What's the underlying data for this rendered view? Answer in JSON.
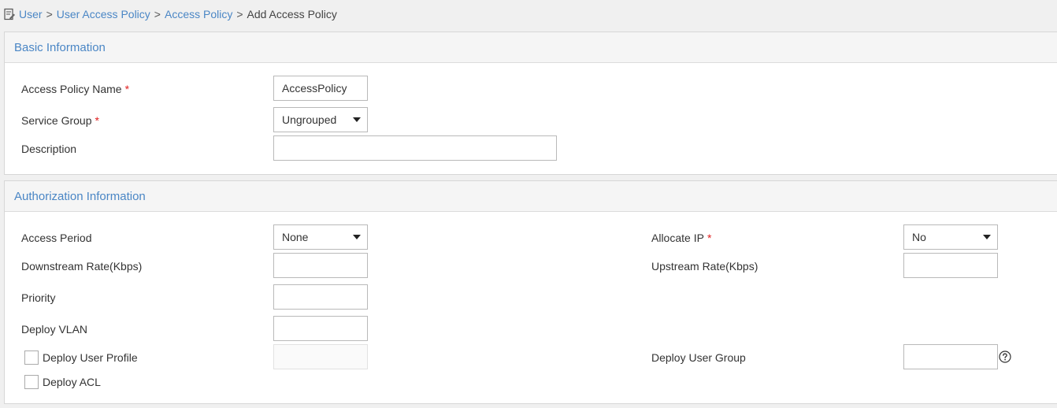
{
  "breadcrumb": {
    "items": [
      "User",
      "User Access Policy",
      "Access Policy"
    ],
    "separator": ">",
    "current": "Add Access Policy"
  },
  "basic": {
    "title": "Basic Information",
    "policy_name": {
      "label": "Access Policy Name",
      "required": "*",
      "value": "AccessPolicy"
    },
    "service_group": {
      "label": "Service Group",
      "required": "*",
      "value": "Ungrouped"
    },
    "description": {
      "label": "Description",
      "value": ""
    }
  },
  "auth": {
    "title": "Authorization Information",
    "access_period": {
      "label": "Access Period",
      "value": "None"
    },
    "allocate_ip": {
      "label": "Allocate IP",
      "required": "*",
      "value": "No"
    },
    "downstream_rate": {
      "label": "Downstream Rate(Kbps)",
      "value": ""
    },
    "upstream_rate": {
      "label": "Upstream Rate(Kbps)",
      "value": ""
    },
    "priority": {
      "label": "Priority",
      "value": ""
    },
    "deploy_vlan": {
      "label": "Deploy VLAN",
      "value": ""
    },
    "deploy_user_profile": {
      "label": "Deploy User Profile",
      "checked": false,
      "value": ""
    },
    "deploy_user_group": {
      "label": "Deploy User Group",
      "value": ""
    },
    "deploy_acl": {
      "label": "Deploy ACL",
      "checked": false
    }
  },
  "colors": {
    "link": "#4a86c5",
    "required": "#e02020",
    "panel_border": "#d7d7d7"
  },
  "icons": {
    "breadcrumb": "user-document-icon",
    "help": "question-circle-icon",
    "dropdown": "caret-down-icon"
  }
}
